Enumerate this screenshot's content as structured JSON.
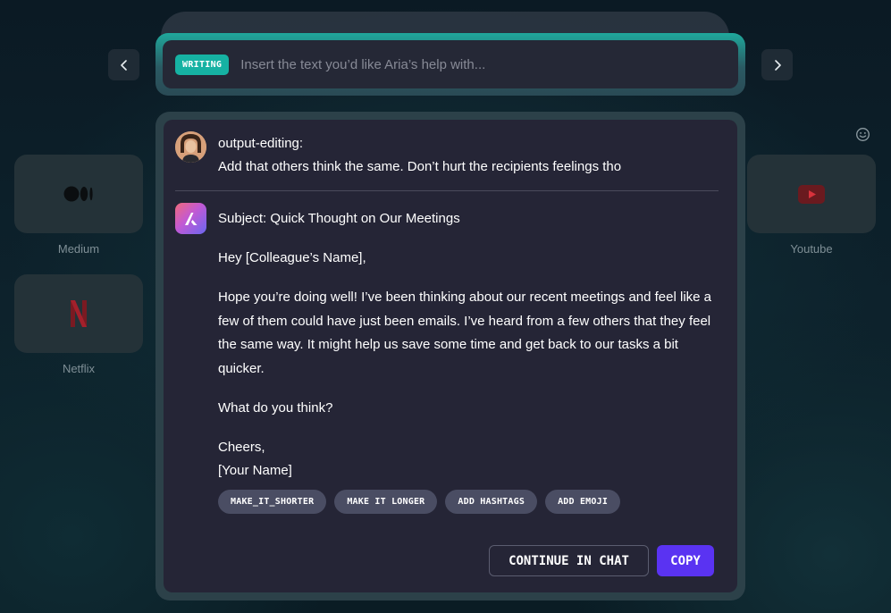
{
  "writing_bar": {
    "badge": "WRITING",
    "placeholder": "Insert the text you’d like Aria’s help with..."
  },
  "nav": {
    "prev_icon": "chevron-left-icon",
    "next_icon": "chevron-right-icon"
  },
  "tiles": {
    "medium": "Medium",
    "netflix": "Netflix",
    "youtube": "Youtube"
  },
  "conversation": {
    "user": {
      "name": "output-editing:",
      "message": "Add that others think the same. Don’t hurt the recipients feelings tho"
    },
    "reply": {
      "subject": "Subject: Quick Thought on Our Meetings",
      "greeting": "Hey [Colleague’s Name],",
      "body_1": "Hope you’re doing well! I’ve been thinking about our recent meetings and feel like a few of them could have just been emails. I’ve heard from a few others that they feel the same way. It might help us save some time and get back to our tasks a bit quicker.",
      "question": "What do you think?",
      "signoff": "Cheers,",
      "signature": "[Your Name]"
    }
  },
  "chips": [
    "MAKE_IT_SHORTER",
    "MAKE IT LONGER",
    "ADD HASHTAGS",
    "ADD EMOJI"
  ],
  "actions": {
    "continue": "CONTINUE IN CHAT",
    "copy": "COPY"
  },
  "colors": {
    "accent_teal": "#16b2a3",
    "copy_purple": "#5a33f2",
    "panel_bg": "#252536"
  }
}
